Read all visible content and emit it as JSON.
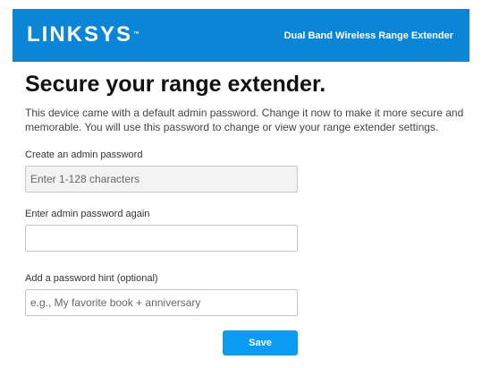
{
  "header": {
    "logo": "LINKSYS",
    "logo_mark": "™",
    "product_name": "Dual Band Wireless Range Extender"
  },
  "page": {
    "title": "Secure your range extender.",
    "description": "This device came with a default admin password. Change it now to make it more secure and memorable. You will use this password to change or view your range extender settings."
  },
  "form": {
    "admin_password": {
      "label": "Create an admin password",
      "value": "",
      "placeholder": "Enter 1-128 characters"
    },
    "confirm_password": {
      "label": "Enter admin password again",
      "value": "",
      "placeholder": ""
    },
    "hint": {
      "label": "Add a password hint (optional)",
      "value": "",
      "placeholder": "e.g., My favorite book + anniversary"
    },
    "save_label": "Save"
  },
  "colors": {
    "header_bg": "#0b86d6",
    "button_bg": "#0b9bf2"
  }
}
